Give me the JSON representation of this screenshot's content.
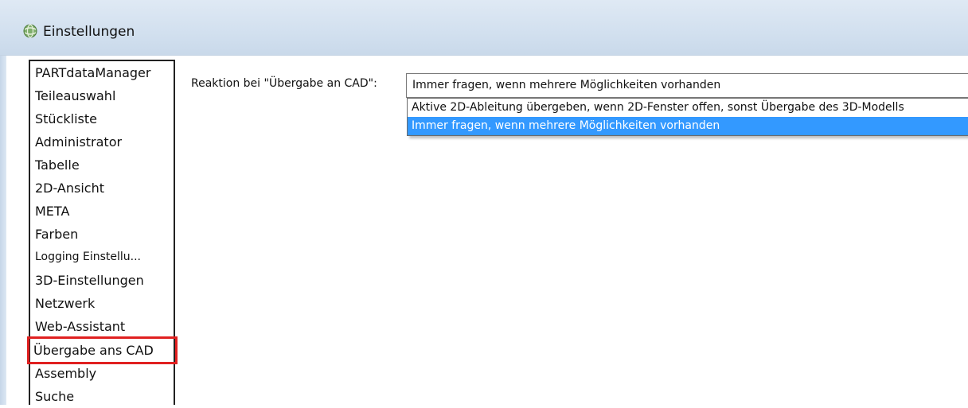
{
  "window": {
    "title": "Einstellungen"
  },
  "sidebar": {
    "items": [
      {
        "label": "PARTdataManager"
      },
      {
        "label": "Teileauswahl"
      },
      {
        "label": "Stückliste"
      },
      {
        "label": "Administrator"
      },
      {
        "label": "Tabelle"
      },
      {
        "label": "2D-Ansicht"
      },
      {
        "label": "META"
      },
      {
        "label": "Farben"
      },
      {
        "label": "Logging Einstellu..."
      },
      {
        "label": "3D-Einstellungen"
      },
      {
        "label": "Netzwerk"
      },
      {
        "label": "Web-Assistant"
      },
      {
        "label": "Übergabe ans CAD"
      },
      {
        "label": "Assembly"
      },
      {
        "label": "Suche"
      }
    ],
    "selected_index": 12
  },
  "settings": {
    "reaction_label": "Reaktion bei \"Übergabe an CAD\":",
    "reaction_value": "Immer fragen, wenn mehrere Möglichkeiten vorhanden",
    "options": [
      "Aktive 2D-Ableitung übergeben, wenn 2D-Fenster offen, sonst Übergabe des 3D-Modells",
      "Immer fragen, wenn mehrere Möglichkeiten vorhanden"
    ],
    "selected_option_index": 1
  },
  "colors": {
    "selection": "#3399ff",
    "highlight_box": "#e02020",
    "titlebar": "#d2e0ef"
  }
}
